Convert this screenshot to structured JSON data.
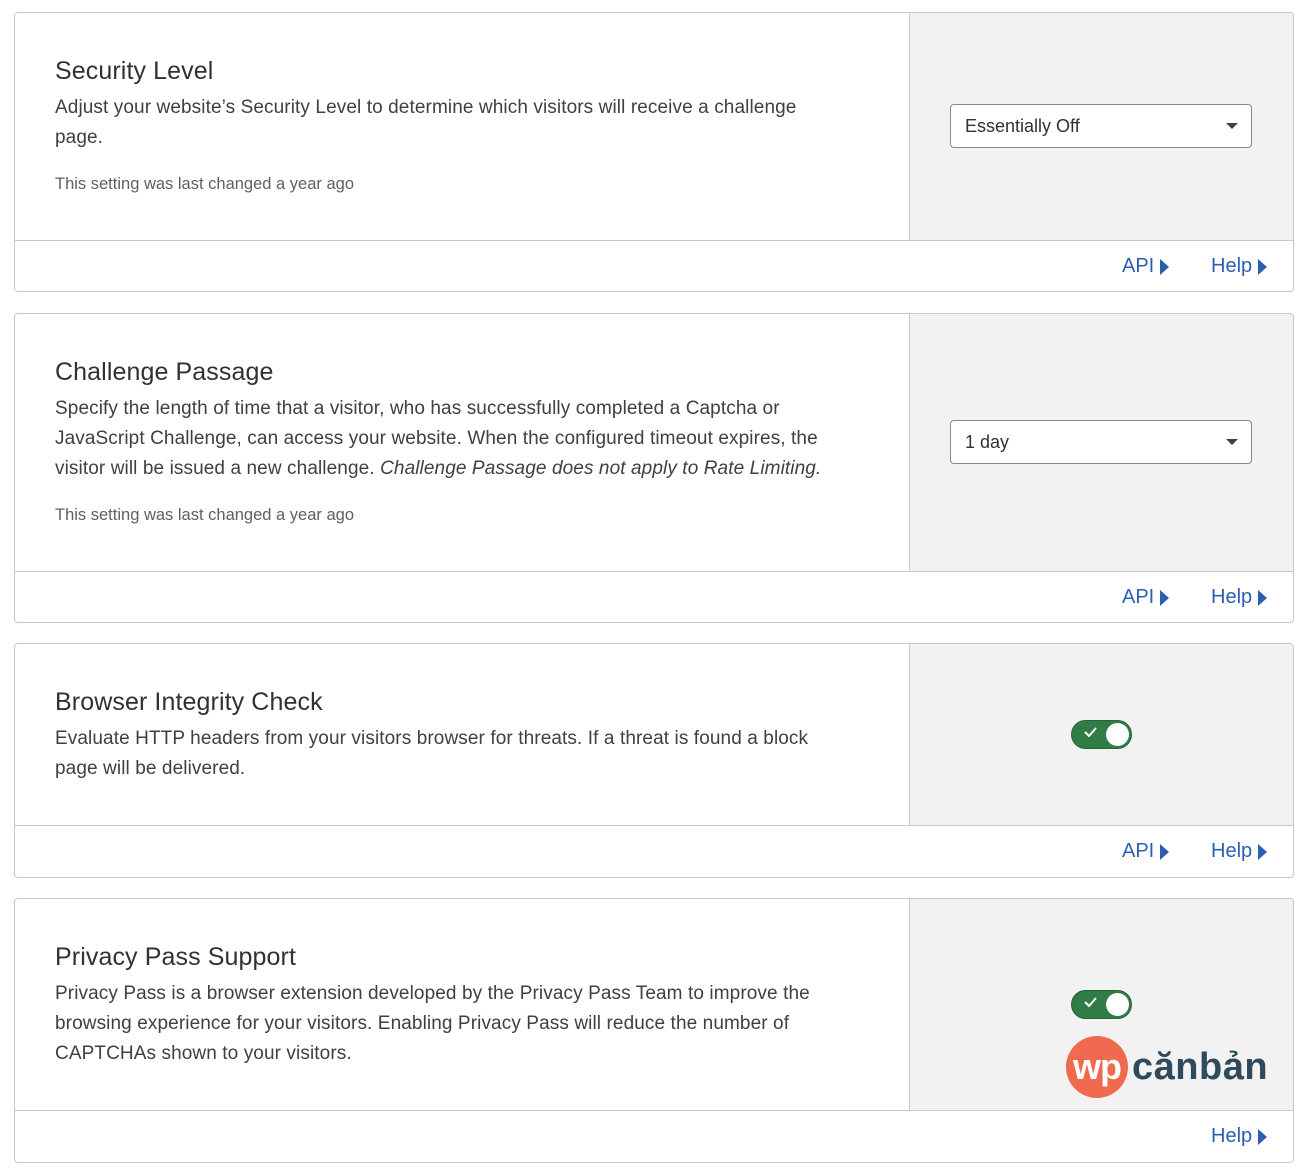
{
  "cards": [
    {
      "title": "Security Level",
      "description": "Adjust your website’s Security Level to determine which visitors will receive a challenge page.",
      "last_changed": "This setting was last changed a year ago",
      "control": {
        "type": "select",
        "value": "Essentially Off"
      },
      "footer": {
        "api_label": "API",
        "help_label": "Help"
      }
    },
    {
      "title": "Challenge Passage",
      "description": "Specify the length of time that a visitor, who has successfully completed a Captcha or JavaScript Challenge, can access your website. When the configured timeout expires, the visitor will be issued a new challenge.",
      "description_italic": "Challenge Passage does not apply to Rate Limiting.",
      "last_changed": "This setting was last changed a year ago",
      "control": {
        "type": "select",
        "value": "1 day"
      },
      "footer": {
        "api_label": "API",
        "help_label": "Help"
      }
    },
    {
      "title": "Browser Integrity Check",
      "description": "Evaluate HTTP headers from your visitors browser for threats. If a threat is found a block page will be delivered.",
      "control": {
        "type": "toggle",
        "state": "on"
      },
      "footer": {
        "api_label": "API",
        "help_label": "Help"
      }
    },
    {
      "title": "Privacy Pass Support",
      "description": "Privacy Pass is a browser extension developed by the Privacy Pass Team to improve the browsing experience for your visitors. Enabling Privacy Pass will reduce the number of CAPTCHAs shown to your visitors.",
      "control": {
        "type": "toggle",
        "state": "on"
      },
      "footer": {
        "help_label": "Help"
      }
    }
  ],
  "watermark": {
    "logo_circle": "wp",
    "logo_text": "cănbản"
  },
  "colors": {
    "link": "#2c5fb3",
    "toggle_on": "#2f7d44",
    "panel_bg": "#f2f2f2",
    "logo_accent": "#f06a4f"
  },
  "icons": {
    "footer_link": "caret-right-icon",
    "select": "chevron-down-icon",
    "toggle": "check-icon"
  }
}
